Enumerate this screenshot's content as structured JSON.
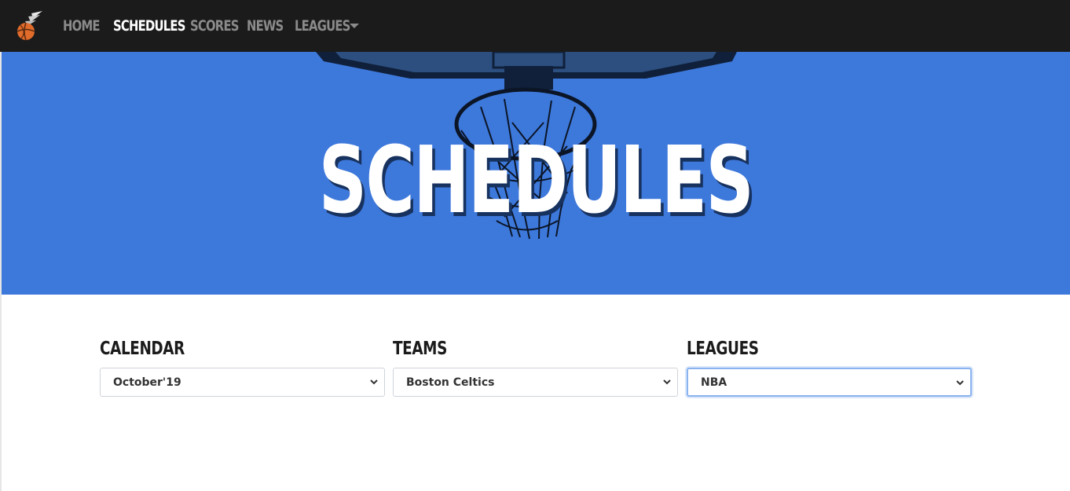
{
  "nav": {
    "items": [
      {
        "label": "HOME",
        "active": false
      },
      {
        "label": "SCHEDULES",
        "active": true
      },
      {
        "label": "SCORES",
        "active": false
      },
      {
        "label": "NEWS",
        "active": false
      }
    ],
    "dropdown_label": "LEAGUES"
  },
  "hero": {
    "title": "SCHEDULES",
    "background_color": "#3d78db"
  },
  "filters": {
    "calendar": {
      "label": "CALENDAR",
      "value": "October'19"
    },
    "teams": {
      "label": "TEAMS",
      "value": "Boston Celtics"
    },
    "leagues": {
      "label": "LEAGUES",
      "value": "NBA"
    }
  },
  "colors": {
    "navbar": "#1b1b1b",
    "nav_inactive": "#8b8b8b",
    "nav_active": "#ffffff",
    "logo_ball": "#e06b2a"
  },
  "icons": {
    "logo": "basketball-logo-icon",
    "dropdown": "caret-down-icon",
    "select_chevron": "chevron-down-icon"
  }
}
